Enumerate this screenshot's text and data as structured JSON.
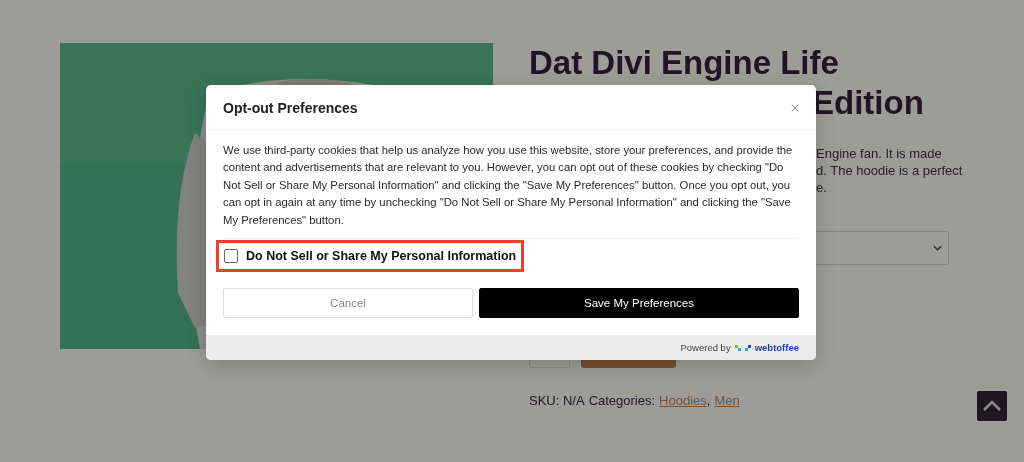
{
  "page": {
    "picture": {
      "kind": "picture"
    },
    "title_lines": [
      "Dat Divi Engine Life",
      "Edition"
    ],
    "description_lines": [
      "Engine fan. It is made",
      "d. The hoodie is a perfect",
      "e."
    ],
    "sku": "SKU: N/A",
    "categories_label": "Categories:",
    "categories": [
      {
        "label": "Hoodies"
      },
      {
        "label": "Men"
      }
    ],
    "separator": ","
  },
  "modal": {
    "title": "Opt-out Preferences",
    "body": "We use third-party cookies that help us analyze how you use this website, store your preferences, and provide the content and advertisements that are relevant to you. However, you can opt out of these cookies by checking \"Do Not Sell or Share My Personal Information\" and clicking the \"Save My Preferences\" button. Once you opt out, you can opt in again at any time by unchecking \"Do Not Sell or Share My Personal Information\" and clicking the \"Save My Preferences\" button.",
    "option": {
      "label": "Do Not Sell or Share My Personal Information",
      "checked": false,
      "highlighted": true
    },
    "buttons": [
      {
        "label": "Cancel",
        "kind": "secondary"
      },
      {
        "label": "Save My Preferences",
        "kind": "primary"
      }
    ],
    "footer": {
      "powered_by": "Powered by",
      "brand": "webtoffee"
    }
  }
}
